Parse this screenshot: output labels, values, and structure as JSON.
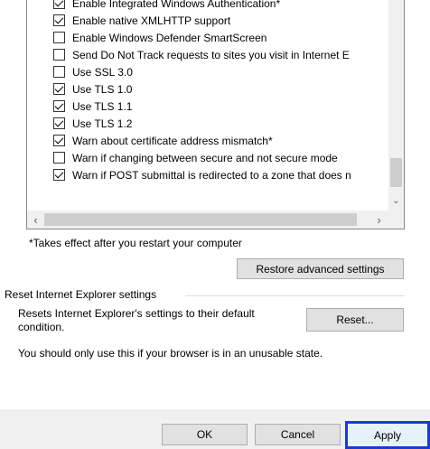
{
  "advanced": {
    "options": [
      {
        "label": "Enable Integrated Windows Authentication*",
        "checked": true
      },
      {
        "label": "Enable native XMLHTTP support",
        "checked": true
      },
      {
        "label": "Enable Windows Defender SmartScreen",
        "checked": false
      },
      {
        "label": "Send Do Not Track requests to sites you visit in Internet E",
        "checked": false
      },
      {
        "label": "Use SSL 3.0",
        "checked": false
      },
      {
        "label": "Use TLS 1.0",
        "checked": true
      },
      {
        "label": "Use TLS 1.1",
        "checked": true
      },
      {
        "label": "Use TLS 1.2",
        "checked": true
      },
      {
        "label": "Warn about certificate address mismatch*",
        "checked": true
      },
      {
        "label": "Warn if changing between secure and not secure mode",
        "checked": false
      },
      {
        "label": "Warn if POST submittal is redirected to a zone that does n",
        "checked": true
      }
    ],
    "note": "*Takes effect after you restart your computer",
    "restore_label": "Restore advanced settings"
  },
  "reset": {
    "group_title": "Reset Internet Explorer settings",
    "description": "Resets Internet Explorer's settings to their default condition.",
    "button_label": "Reset...",
    "warning": "You should only use this if your browser is in an unusable state."
  },
  "footer": {
    "ok_label": "OK",
    "cancel_label": "Cancel",
    "apply_label": "Apply"
  },
  "icons": {
    "scroll_left": "‹",
    "scroll_right": "›",
    "scroll_down": "⌄"
  }
}
